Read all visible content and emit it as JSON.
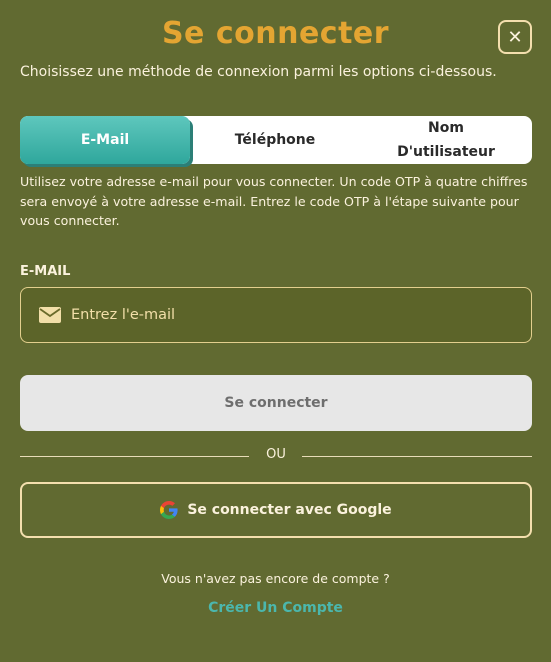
{
  "modal": {
    "title": "Se connecter",
    "close_label": "✕",
    "subtitle": "Choisissez une méthode de connexion parmi les options ci-dessous."
  },
  "tabs": [
    {
      "label": "E-Mail",
      "active": true
    },
    {
      "label": "Téléphone",
      "active": false
    },
    {
      "label": "Nom D'utilisateur",
      "active": false
    }
  ],
  "help_text": "Utilisez votre adresse e-mail pour vous connecter. Un code OTP à quatre chiffres sera envoyé à votre adresse e-mail. Entrez le code OTP à l'étape suivante pour vous connecter.",
  "email": {
    "label": "E-MAIL",
    "placeholder": "Entrez l'e-mail",
    "value": "",
    "icon": "mail-icon"
  },
  "submit_label": "Se connecter",
  "divider_label": "OU",
  "google": {
    "label": "Se connecter avec Google",
    "icon": "google-icon"
  },
  "footer": {
    "no_account": "Vous n'avez pas encore de compte ?",
    "create_link": "Créer Un Compte"
  },
  "colors": {
    "background": "#616a31",
    "title": "#e4a532",
    "accent": "#4bb7ad",
    "active_tab": "#3fb4a9"
  }
}
